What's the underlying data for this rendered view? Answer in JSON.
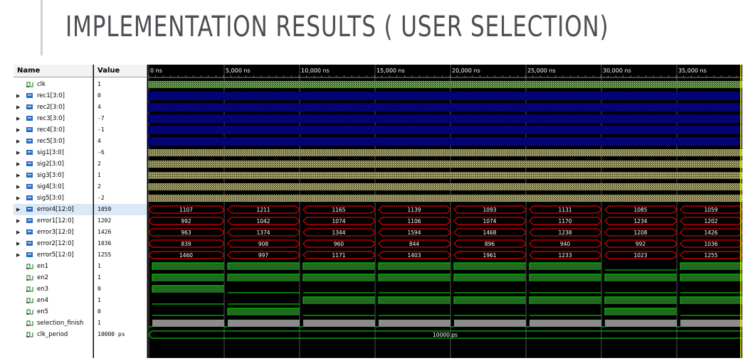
{
  "slide": {
    "title": "IMPLEMENTATION RESULTS ( USER SELECTION)"
  },
  "simulator": {
    "name_header": "Name",
    "value_header": "Value",
    "time_markers": [
      "0 ns",
      "5,000 ns",
      "10,000 ns",
      "15,000 ns",
      "20,000 ns",
      "25,000 ns",
      "30,000 ns",
      "35,000 ns"
    ],
    "colors": {
      "bus_blue": "#000070",
      "hatch_yellow": "#c9c48a",
      "hatch_green": "#88d070",
      "bus_red": "#e00000",
      "logic_green": "#00c000",
      "finish_gray": "#8c8c8c",
      "grid": "#555555"
    },
    "signals": [
      {
        "name": "clk",
        "value": "1",
        "kind": "bit",
        "expandable": false,
        "icon": "bit-signal-icon",
        "wave": "clock"
      },
      {
        "name": "rec1[3:0]",
        "value": "0",
        "kind": "bus",
        "expandable": true,
        "icon": "bus-signal-icon",
        "wave": "blue"
      },
      {
        "name": "rec2[3:0]",
        "value": "4",
        "kind": "bus",
        "expandable": true,
        "icon": "bus-signal-icon",
        "wave": "blue"
      },
      {
        "name": "rec3[3:0]",
        "value": "-7",
        "kind": "bus",
        "expandable": true,
        "icon": "bus-signal-icon",
        "wave": "blue"
      },
      {
        "name": "rec4[3:0]",
        "value": "-1",
        "kind": "bus",
        "expandable": true,
        "icon": "bus-signal-icon",
        "wave": "blue"
      },
      {
        "name": "rec5[3:0]",
        "value": "4",
        "kind": "bus",
        "expandable": true,
        "icon": "bus-signal-icon",
        "wave": "blue"
      },
      {
        "name": "sig1[3:0]",
        "value": "-6",
        "kind": "bus",
        "expandable": true,
        "icon": "bus-signal-icon",
        "wave": "yellow"
      },
      {
        "name": "sig2[3:0]",
        "value": "2",
        "kind": "bus",
        "expandable": true,
        "icon": "bus-signal-icon",
        "wave": "yellow"
      },
      {
        "name": "sig3[3:0]",
        "value": "1",
        "kind": "bus",
        "expandable": true,
        "icon": "bus-signal-icon",
        "wave": "yellow"
      },
      {
        "name": "sig4[3:0]",
        "value": "2",
        "kind": "bus",
        "expandable": true,
        "icon": "bus-signal-icon",
        "wave": "yellow"
      },
      {
        "name": "sig5[3:0]",
        "value": "-2",
        "kind": "bus",
        "expandable": true,
        "icon": "bus-signal-icon",
        "wave": "yellow"
      },
      {
        "name": "error4[12:0]",
        "value": "1059",
        "kind": "bus",
        "expandable": true,
        "icon": "bus-signal-icon",
        "wave": "red",
        "selected": true,
        "segments": [
          "1107",
          "1211",
          "1165",
          "1139",
          "1093",
          "1131",
          "1085",
          "1059"
        ]
      },
      {
        "name": "error1[12:0]",
        "value": "1202",
        "kind": "bus",
        "expandable": true,
        "icon": "bus-signal-icon",
        "wave": "red",
        "segments": [
          "992",
          "1042",
          "1074",
          "1106",
          "1074",
          "1170",
          "1234",
          "1202"
        ]
      },
      {
        "name": "error3[12:0]",
        "value": "1426",
        "kind": "bus",
        "expandable": true,
        "icon": "bus-signal-icon",
        "wave": "red",
        "segments": [
          "963",
          "1374",
          "1344",
          "1594",
          "1468",
          "1238",
          "1208",
          "1426"
        ]
      },
      {
        "name": "error2[12:0]",
        "value": "1036",
        "kind": "bus",
        "expandable": true,
        "icon": "bus-signal-icon",
        "wave": "red",
        "segments": [
          "839",
          "908",
          "960",
          "844",
          "896",
          "940",
          "992",
          "1036"
        ]
      },
      {
        "name": "error5[12:0]",
        "value": "1255",
        "kind": "bus",
        "expandable": true,
        "icon": "bus-signal-icon",
        "wave": "red",
        "segments": [
          "1460",
          "997",
          "1171",
          "1403",
          "1961",
          "1233",
          "1023",
          "1255"
        ]
      },
      {
        "name": "en1",
        "value": "1",
        "kind": "bit",
        "expandable": false,
        "icon": "bit-signal-icon",
        "wave": "digital",
        "levels": [
          1,
          1,
          1,
          1,
          1,
          1,
          0,
          1
        ]
      },
      {
        "name": "en2",
        "value": "1",
        "kind": "bit",
        "expandable": false,
        "icon": "bit-signal-icon",
        "wave": "digital",
        "levels": [
          1,
          1,
          1,
          1,
          1,
          1,
          1,
          1
        ]
      },
      {
        "name": "en3",
        "value": "0",
        "kind": "bit",
        "expandable": false,
        "icon": "bit-signal-icon",
        "wave": "digital",
        "levels": [
          1,
          0,
          0,
          0,
          0,
          0,
          0,
          0
        ]
      },
      {
        "name": "en4",
        "value": "1",
        "kind": "bit",
        "expandable": false,
        "icon": "bit-signal-icon",
        "wave": "digital",
        "levels": [
          0,
          0,
          1,
          1,
          1,
          1,
          1,
          1
        ]
      },
      {
        "name": "en5",
        "value": "0",
        "kind": "bit",
        "expandable": false,
        "icon": "bit-signal-icon",
        "wave": "digital",
        "levels": [
          0,
          1,
          0,
          0,
          0,
          0,
          1,
          0
        ]
      },
      {
        "name": "selection_finish",
        "value": "1",
        "kind": "bit",
        "expandable": false,
        "icon": "bit-signal-icon",
        "wave": "pulse"
      },
      {
        "name": "clk_period",
        "value": "10000 ps",
        "kind": "param",
        "expandable": false,
        "icon": "bit-signal-icon",
        "wave": "const",
        "segments": [
          "10000 ps"
        ]
      }
    ]
  }
}
